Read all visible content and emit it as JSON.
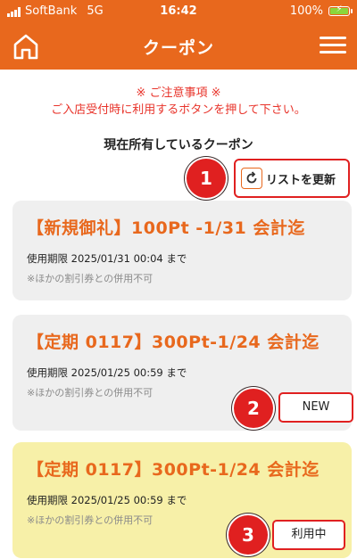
{
  "status_bar": {
    "carrier": "SoftBank",
    "network": "5G",
    "time": "16:42",
    "battery": "100%"
  },
  "nav": {
    "title": "クーポン",
    "home_icon": "home-icon",
    "menu_icon": "hamburger-menu-icon"
  },
  "notice": {
    "line1": "※ ご注意事項 ※",
    "line2": "ご入店受付時に利用するボタンを押して下さい。"
  },
  "section_title": "現在所有しているクーポン",
  "refresh": {
    "label": "リストを更新",
    "icon": "refresh-icon"
  },
  "markers": [
    "1",
    "2",
    "3"
  ],
  "coupons": [
    {
      "title": "【新規御礼】100Pt -1/31 会計迄",
      "expiry": "使用期限 2025/01/31 00:04 まで",
      "note": "※ほかの割引券との併用不可"
    },
    {
      "title": "【定期 0117】300Pt-1/24 会計迄",
      "expiry": "使用期限 2025/01/25 00:59 まで",
      "note": "※ほかの割引券との併用不可",
      "tag": "NEW"
    },
    {
      "title": "【定期 0117】300Pt-1/24 会計迄",
      "expiry": "使用期限 2025/01/25 00:59 まで",
      "note": "※ほかの割引券との併用不可",
      "tag": "利用中"
    }
  ],
  "colors": {
    "brand": "#e8681d",
    "alert": "#e02020",
    "active_card": "#f7f0a8",
    "card": "#efefef"
  }
}
